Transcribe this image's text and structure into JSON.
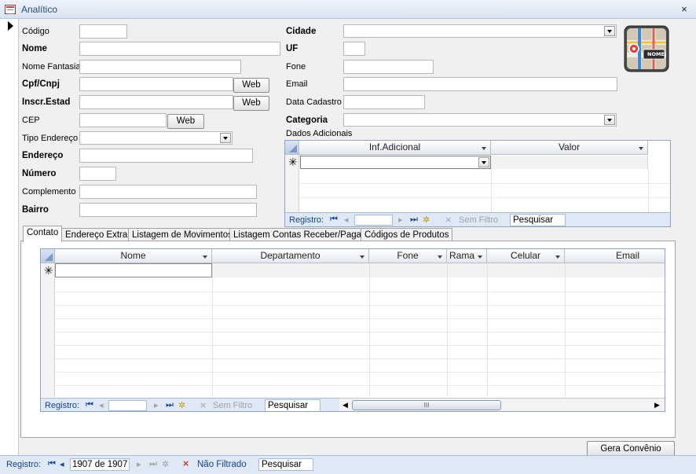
{
  "window": {
    "title": "Analítico",
    "close_symbol": "×"
  },
  "fields_left": {
    "codigo": {
      "label": "Código",
      "value": ""
    },
    "nome": {
      "label": "Nome",
      "value": ""
    },
    "nome_fantasia": {
      "label": "Nome Fantasia",
      "value": ""
    },
    "cpf_cnpj": {
      "label": "Cpf/Cnpj",
      "value": "",
      "button": "Web"
    },
    "inscr_estad": {
      "label": "Inscr.Estad",
      "value": "",
      "button": "Web"
    },
    "cep": {
      "label": "CEP",
      "value": "",
      "button": "Web"
    },
    "tipo_endereco": {
      "label": "Tipo Endereço",
      "value": ""
    },
    "endereco": {
      "label": "Endereço",
      "value": ""
    },
    "numero": {
      "label": "Número",
      "value": ""
    },
    "complemento": {
      "label": "Complemento",
      "value": ""
    },
    "bairro": {
      "label": "Bairro",
      "value": ""
    }
  },
  "fields_right": {
    "cidade": {
      "label": "Cidade",
      "value": ""
    },
    "uf": {
      "label": "UF",
      "value": ""
    },
    "fone": {
      "label": "Fone",
      "value": ""
    },
    "email": {
      "label": "Email",
      "value": ""
    },
    "data_cadastro": {
      "label": "Data Cadastro",
      "value": ""
    },
    "categoria": {
      "label": "Categoria",
      "value": ""
    }
  },
  "map_icon": {
    "badge": "NOME"
  },
  "dados_adicionais": {
    "label": "Dados Adicionais",
    "columns": [
      "Inf.Adicional",
      "Valor"
    ],
    "new_row_symbol": "✳",
    "nav": {
      "label": "Registro:",
      "filter": "Sem Filtro",
      "search": "Pesquisar"
    }
  },
  "tabs": [
    {
      "label": "Contato",
      "active": true
    },
    {
      "label": "Endereço Extra",
      "active": false
    },
    {
      "label": "Listagem de Movimentos",
      "active": false
    },
    {
      "label": "Listagem Contas Receber/Pagar",
      "active": false
    },
    {
      "label": "Códigos de Produtos",
      "active": false
    }
  ],
  "contato_grid": {
    "columns": [
      "Nome",
      "Departamento",
      "Fone",
      "Rama",
      "Celular",
      "Email"
    ],
    "new_row_symbol": "✳",
    "nav": {
      "label": "Registro:",
      "filter": "Sem Filtro",
      "search": "Pesquisar"
    },
    "scroll_grip": "III"
  },
  "footer": {
    "gera_convenio": "Gera Convênio",
    "nav_label": "Registro:",
    "record": "1907 de 1907",
    "filter": "Não Filtrado",
    "search": "Pesquisar"
  }
}
